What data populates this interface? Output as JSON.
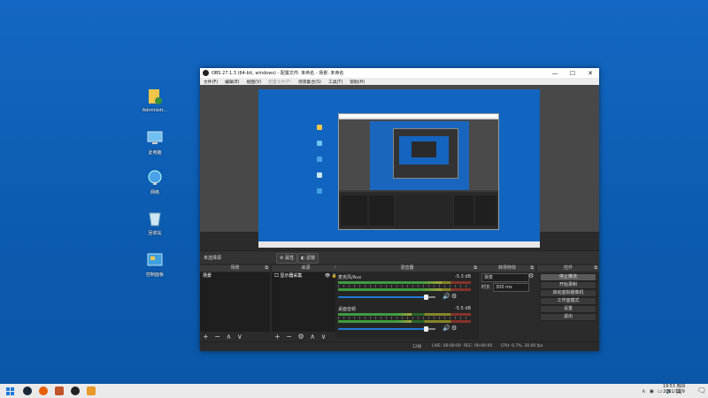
{
  "desktop": {
    "icons": [
      {
        "label": "Administr...",
        "icon": "user-folder-icon"
      },
      {
        "label": "此电脑",
        "icon": "computer-icon"
      },
      {
        "label": "网络",
        "icon": "network-icon"
      },
      {
        "label": "回收站",
        "icon": "recycle-bin-icon"
      },
      {
        "label": "控制面板",
        "icon": "control-panel-icon"
      }
    ]
  },
  "obs": {
    "title": "OBS 27.1.3 (64-bit, windows) - 配置文件: 未命名 - 场景: 未命名",
    "window_buttons": {
      "minimize": "—",
      "maximize": "☐",
      "close": "✕"
    },
    "menu": [
      "文件(F)",
      "编辑(E)",
      "视图(V)",
      "配置文件(P)",
      "场景集合(S)",
      "工具(T)",
      "帮助(H)"
    ],
    "modebar": {
      "no_source": "未选择源",
      "properties": "属性",
      "filters": "滤镜"
    },
    "docks": {
      "scenes": {
        "title": "场景",
        "items": [
          "场景"
        ]
      },
      "sources": {
        "title": "来源",
        "items": [
          "显示器采集"
        ]
      },
      "mixer": {
        "title": "混音器",
        "channels": [
          {
            "name": "麦克风/Aux",
            "db": "-5.3 dB",
            "level": 0.78,
            "volume": 0.9
          },
          {
            "name": "桌面音频",
            "db": "-5.5 dB",
            "level": 0.55,
            "volume": 0.9
          }
        ]
      },
      "transitions": {
        "title": "转场特效",
        "type": "渐变",
        "duration_label": "时长",
        "duration": "300 ms"
      },
      "controls": {
        "title": "控件",
        "buttons": [
          "停止推流",
          "开始录制",
          "启动虚拟摄像机",
          "工作室模式",
          "设置",
          "退出"
        ]
      }
    },
    "status": {
      "dropped": "12帧",
      "live": "LIVE: 00:00:00",
      "rec": "REC: 00:00:00",
      "cpu": "CPU: 0.7%, 30.00 fps"
    }
  },
  "taskbar": {
    "apps": [
      "start-icon",
      "steam-icon",
      "firefox-icon",
      "app-icon",
      "obs-icon",
      "files-icon"
    ],
    "tray_lang": "英",
    "time": "19:53 周四",
    "date": "2021/12/9",
    "colors": {
      "accent": "#1e7ad7",
      "desktop": "#0f5fb4"
    }
  }
}
